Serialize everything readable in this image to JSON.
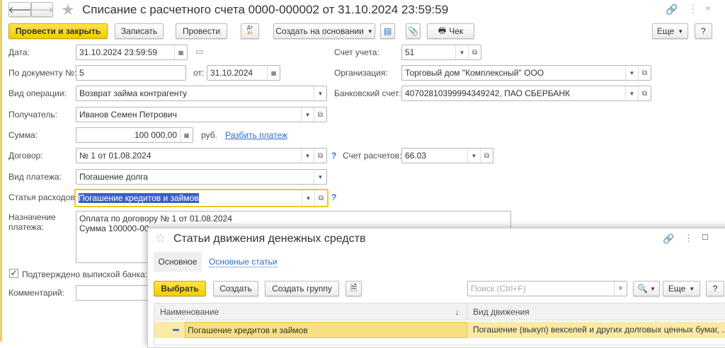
{
  "window": {
    "title": "Списание с расчетного счета 0000-000002 от 31.10.2024 23:59:59"
  },
  "toolbar": {
    "post_close": "Провести и закрыть",
    "save": "Записать",
    "post": "Провести",
    "dtkt_dt": "Дт",
    "dtkt_kt": "Кт",
    "create_based": "Создать на основании",
    "check": "Чек",
    "more": "Еще",
    "help": "?"
  },
  "form": {
    "date_label": "Дата:",
    "date": "31.10.2024 23:59:59",
    "docnum_label": "По документу №:",
    "docnum": "5",
    "from_label": "от:",
    "from_date": "31.10.2024",
    "op_label": "Вид операции:",
    "op": "Возврат займа контрагенту",
    "recipient_label": "Получатель:",
    "recipient": "Иванов Семен Петрович",
    "sum_label": "Сумма:",
    "sum": "100 000,00",
    "currency": "руб.",
    "split_link": "Разбить платеж",
    "contract_label": "Договор:",
    "contract": "№ 1 от 01.08.2024",
    "paytype_label": "Вид платежа:",
    "paytype": "Погашение долга",
    "expense_label": "Статья расходов:",
    "expense": "Погашение кредитов и займов",
    "purpose_label_1": "Назначение",
    "purpose_label_2": "платежа:",
    "purpose_1": "Оплата по договору № 1 от 01.08.2024",
    "purpose_2": "Сумма 100000-00",
    "confirmed_label": "Подтверждено выпиской банка:",
    "confirmed": true,
    "comment_label": "Комментарий:",
    "comment": "",
    "account_label": "Счет учета:",
    "account": "51",
    "org_label": "Организация:",
    "org": "Торговый дом \"Комплексный\" ООО",
    "bank_label": "Банковский счет:",
    "bank": "40702810399994349242, ПАО СБЕРБАНК",
    "settle_label": "Счет расчетов:",
    "settle": "66.03",
    "help": "?"
  },
  "popup": {
    "title": "Статьи движения денежных средств",
    "tab_main": "Основное",
    "tab_link": "Основные статьи",
    "select": "Выбрать",
    "create": "Создать",
    "create_group": "Создать группу",
    "search_placeholder": "Поиск (Ctrl+F)",
    "clear": "×",
    "more": "Еще",
    "help": "?",
    "columns": [
      "Наименование",
      "Вид движения"
    ],
    "rows": [
      {
        "name": "Погашение кредитов и займов",
        "kind": "Погашение (выкуп) векселей и других долговых ценных бумаг, ..."
      }
    ]
  },
  "colors": {
    "accent": "#f2cc00",
    "link": "#2a6cc7",
    "selected_row": "#fbeaa6"
  }
}
